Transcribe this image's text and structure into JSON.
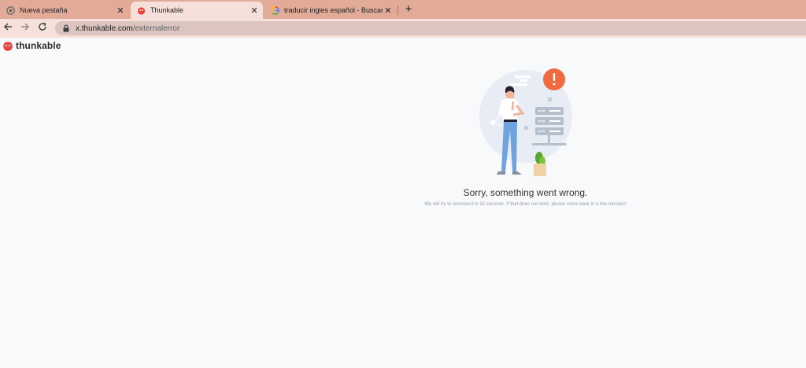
{
  "browser": {
    "tabs": [
      {
        "title": "Nueva pestaña",
        "favicon": "chrome-icon",
        "active": false
      },
      {
        "title": "Thunkable",
        "favicon": "thunkable-icon",
        "active": true
      },
      {
        "title": "traducir ingles español - Buscar c",
        "favicon": "google-icon",
        "active": false
      }
    ],
    "close_glyph": "✕",
    "newtab_glyph": "+",
    "url_host": "x.thunkable.com",
    "url_path": "/externalerror"
  },
  "brand": {
    "name": "thunkable"
  },
  "error": {
    "title": "Sorry, something went wrong.",
    "message": "We will try to reconnect in 15 seconds. If that does not work, please come back in a few minutes!"
  },
  "colors": {
    "tabbar": "#e2ab97",
    "active_tab": "#f6e1da",
    "omnibox": "#dcc5be",
    "alert_badge": "#f26a3f",
    "brand_red": "#e8423a"
  }
}
